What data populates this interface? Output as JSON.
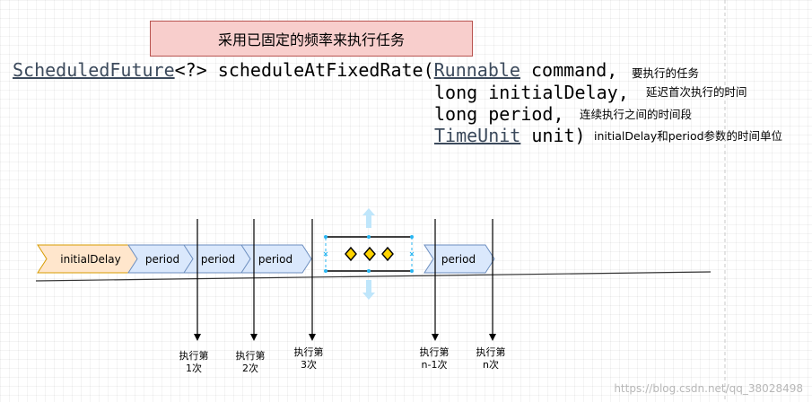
{
  "title": "采用已固定的频率来执行任务",
  "signature": {
    "return_type": "ScheduledFuture",
    "generic": "<?>",
    "method_name": " scheduleAtFixedRate(",
    "params": [
      {
        "type_link": "Runnable",
        "type_plain": "",
        "rest": " command,",
        "note": "要执行的任务"
      },
      {
        "type_link": "",
        "type_plain": "long",
        "rest": " initialDelay,",
        "note": "延迟首次执行的时间"
      },
      {
        "type_link": "",
        "type_plain": "long",
        "rest": " period,",
        "note": "连续执行之间的时间段"
      },
      {
        "type_link": "TimeUnit",
        "type_plain": "",
        "rest": " unit)",
        "note": "initialDelay和period参数的时间单位"
      }
    ]
  },
  "timeline": {
    "segments": [
      {
        "label": "initialDelay",
        "fill": "#ffe6cc",
        "stroke": "#d79b00"
      },
      {
        "label": "period",
        "fill": "#dae8fc",
        "stroke": "#6c8ebf"
      },
      {
        "label": "period",
        "fill": "#dae8fc",
        "stroke": "#6c8ebf"
      },
      {
        "label": "period",
        "fill": "#dae8fc",
        "stroke": "#6c8ebf"
      },
      {
        "label": "period",
        "fill": "#dae8fc",
        "stroke": "#6c8ebf"
      }
    ],
    "executions": [
      {
        "line1": "执行第",
        "line2": "1次"
      },
      {
        "line1": "执行第",
        "line2": "2次"
      },
      {
        "line1": "执行第",
        "line2": "3次"
      },
      {
        "line1": "执行第",
        "line2": "n-1次"
      },
      {
        "line1": "执行第",
        "line2": "n次"
      }
    ]
  },
  "colors": {
    "title_fill": "#f8cecc",
    "title_stroke": "#b85450",
    "link_text": "#3c4a5c",
    "selection_handle": "#29b6f2",
    "diamond_fill": "#ffd400"
  },
  "icons": [
    "ellipsis-diamond-icon",
    "resize-arrow-up-icon",
    "resize-arrow-down-icon"
  ],
  "watermark": "https://blog.csdn.net/qq_38028498"
}
